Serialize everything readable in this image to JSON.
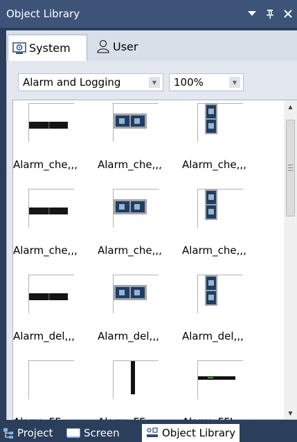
{
  "window": {
    "title": "Object Library",
    "controls": {
      "dropdown": "▾",
      "pin": "ᛘ",
      "close": "✕"
    }
  },
  "tabs": [
    {
      "label": "System",
      "icon": "system-icon",
      "active": true
    },
    {
      "label": "User",
      "icon": "user-icon",
      "active": false
    }
  ],
  "toolbar": {
    "category_value": "Alarm and Logging",
    "zoom_value": "100%"
  },
  "items": [
    {
      "label": "Alarm_che,,,",
      "thumb": "bar-horizontal"
    },
    {
      "label": "Alarm_che,,,",
      "thumb": "box-two-buttons"
    },
    {
      "label": "Alarm_che,,,",
      "thumb": "box-vertical"
    },
    {
      "label": "Alarm_che,,,",
      "thumb": "bar-horizontal"
    },
    {
      "label": "Alarm_che,,,",
      "thumb": "box-two-buttons"
    },
    {
      "label": "Alarm_che,,,",
      "thumb": "box-vertical"
    },
    {
      "label": "Alarm_del,,,",
      "thumb": "bar-horizontal"
    },
    {
      "label": "Alarm_del,,,",
      "thumb": "box-two-buttons"
    },
    {
      "label": "Alarm_del,,,",
      "thumb": "box-vertical"
    },
    {
      "label": "Alarm_FF_,,,",
      "thumb": "empty"
    },
    {
      "label": "Alarm_FF_,,,",
      "thumb": "line-vertical"
    },
    {
      "label": "Alarm_FFI,,,",
      "thumb": "line-horizontal"
    }
  ],
  "bottom_tabs": [
    {
      "label": "Project",
      "icon": "project-tree-icon",
      "active": false
    },
    {
      "label": "Screen",
      "icon": "screen-icon",
      "active": false
    },
    {
      "label": "Object Library",
      "icon": "object-library-icon",
      "active": true
    }
  ],
  "colors": {
    "titlebar": "#3d5478",
    "background": "#2b3f5c",
    "panel": "#e3e8f0"
  }
}
